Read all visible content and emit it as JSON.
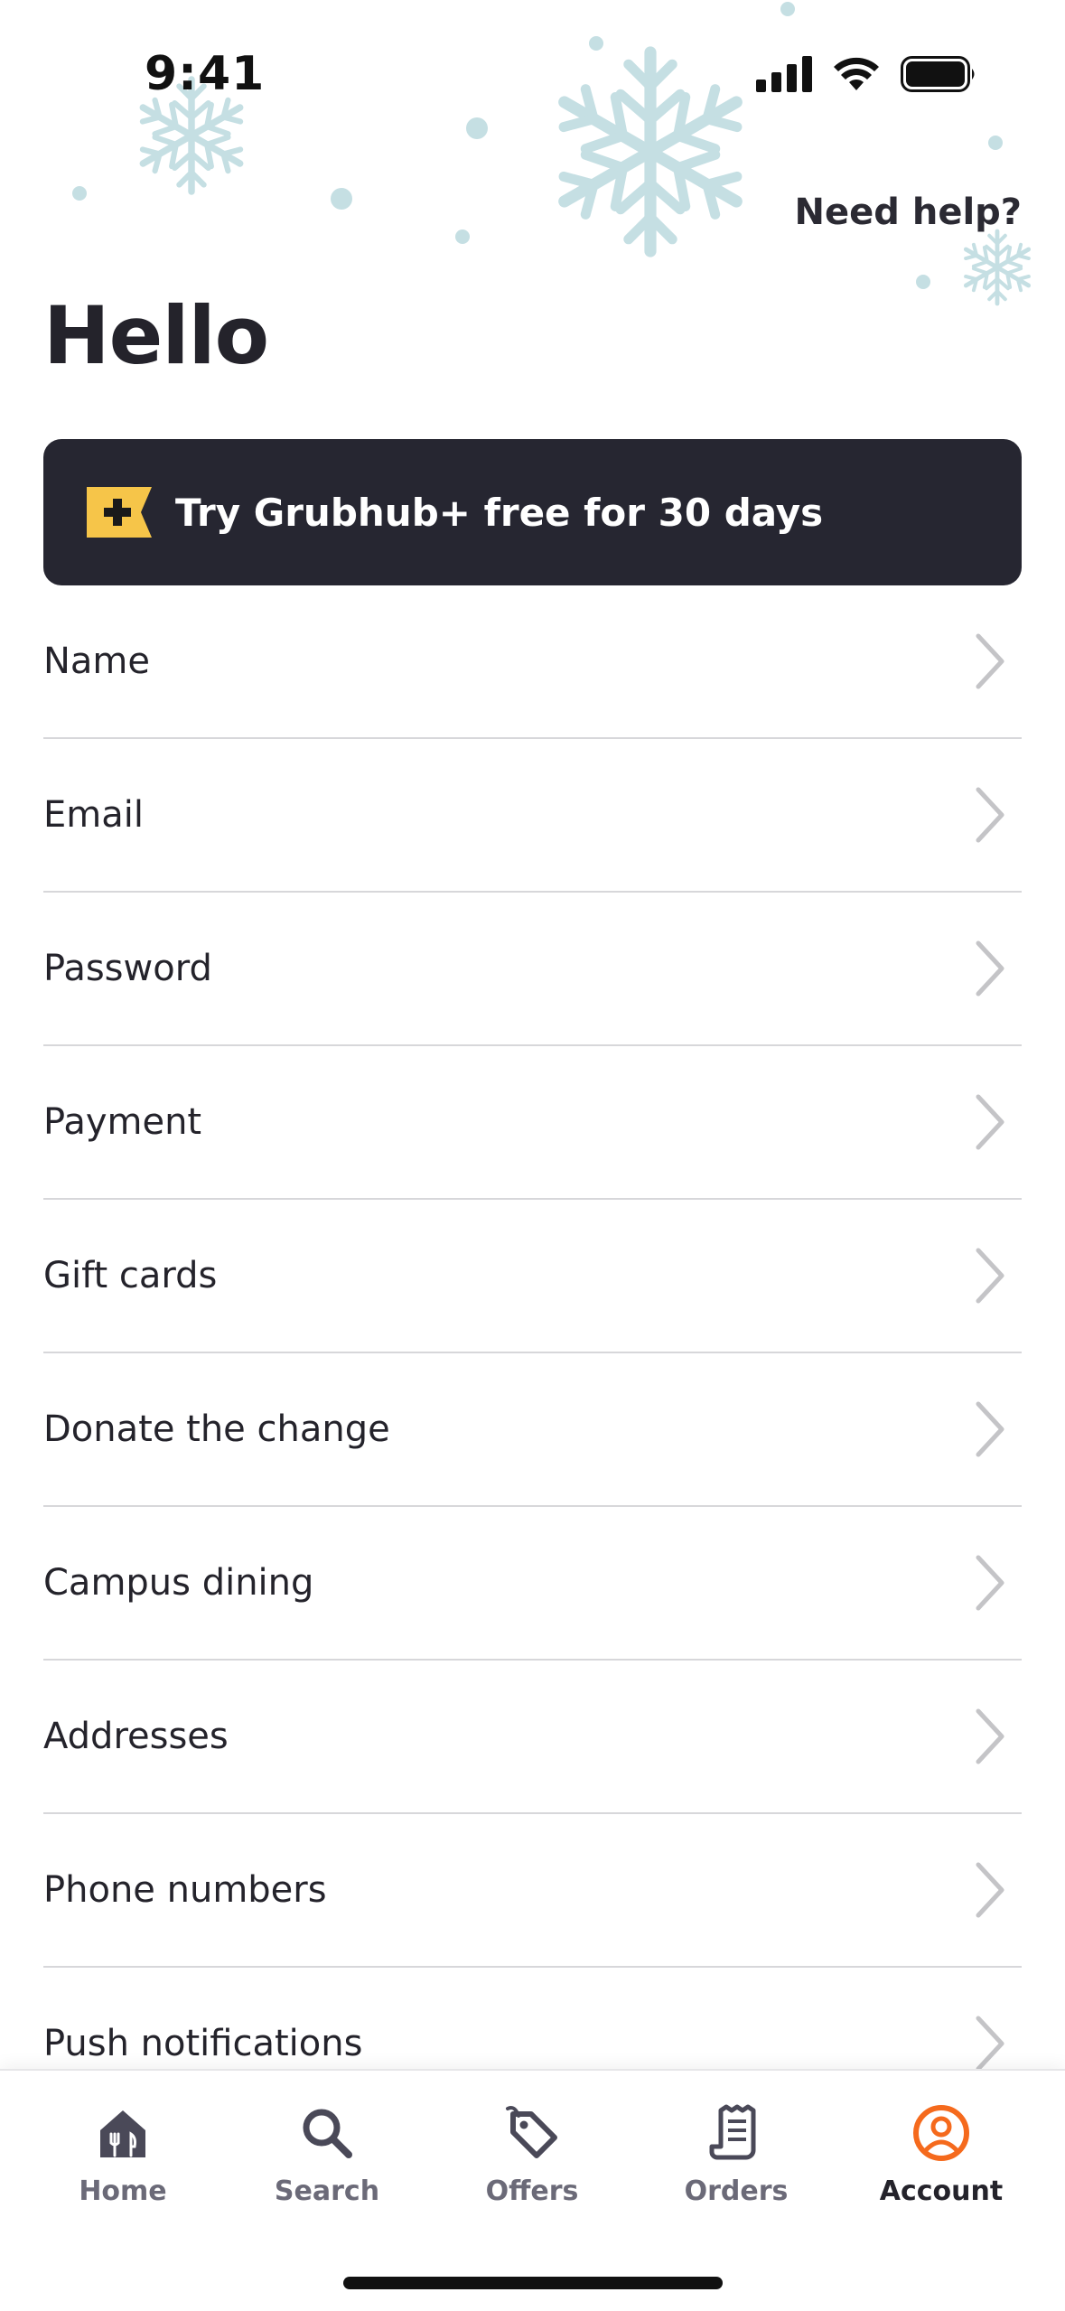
{
  "status_bar": {
    "time": "9:41"
  },
  "header": {
    "help_link": "Need help?",
    "title": "Hello"
  },
  "promo": {
    "text": "Try Grubhub+ free for 30 days",
    "icon": "grubhub-plus-icon",
    "icon_color": "#f6c549"
  },
  "menu": {
    "items": [
      {
        "label": "Name"
      },
      {
        "label": "Email"
      },
      {
        "label": "Password"
      },
      {
        "label": "Payment"
      },
      {
        "label": "Gift cards"
      },
      {
        "label": "Donate the change"
      },
      {
        "label": "Campus dining"
      },
      {
        "label": "Addresses"
      },
      {
        "label": "Phone numbers"
      },
      {
        "label": "Push notifications"
      }
    ]
  },
  "tab_bar": {
    "tabs": [
      {
        "label": "Home",
        "icon": "home-icon"
      },
      {
        "label": "Search",
        "icon": "search-icon"
      },
      {
        "label": "Offers",
        "icon": "tag-icon"
      },
      {
        "label": "Orders",
        "icon": "receipt-icon"
      },
      {
        "label": "Account",
        "icon": "account-icon",
        "active": true
      }
    ]
  },
  "colors": {
    "accent": "#f56a1d",
    "banner_bg": "#262631",
    "text": "#24232b",
    "tab_inactive": "#6b6a78",
    "snowflake": "#c5dfe3"
  }
}
